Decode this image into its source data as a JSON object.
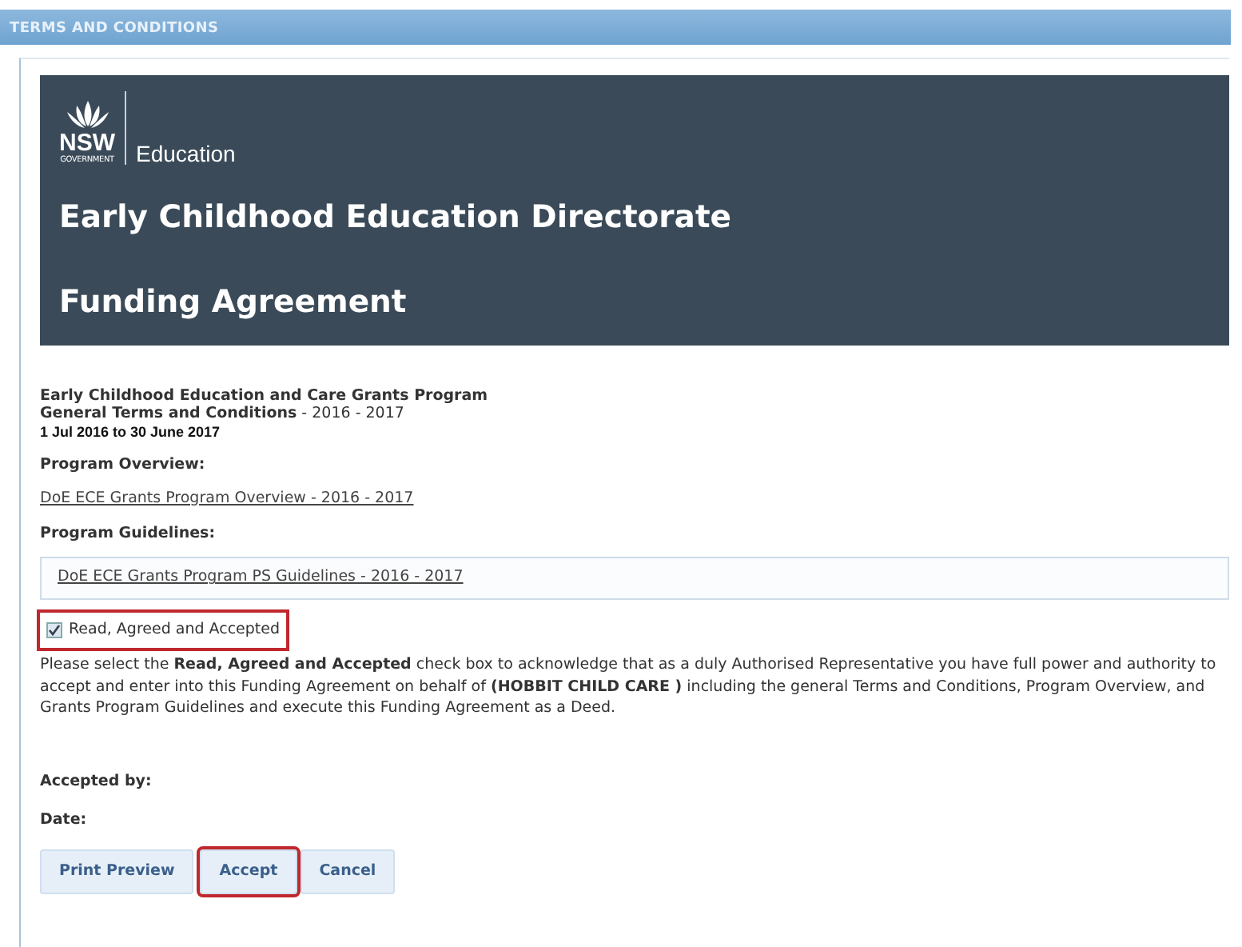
{
  "window": {
    "title": "TERMS AND CONDITIONS"
  },
  "header": {
    "logo_text": "NSW",
    "logo_subtext": "GOVERNMENT",
    "department": "Education",
    "title": "Early Childhood Education Directorate",
    "subtitle": "Funding Agreement"
  },
  "program": {
    "name": "Early Childhood Education and Care Grants Program",
    "terms": "General Terms and Conditions",
    "terms_years": " - 2016 - 2017",
    "period": "1 Jul 2016 to 30 June 2017"
  },
  "sections": [
    {
      "heading": "Program Overview:",
      "link": "DoE ECE Grants Program Overview - 2016 - 2017",
      "boxed": false
    },
    {
      "heading": "Program Guidelines:",
      "link": "DoE ECE Grants Program PS Guidelines - 2016 - 2017",
      "boxed": true
    }
  ],
  "agreement": {
    "label": "Read, Agreed and Accepted",
    "checked": true,
    "highlighted": true
  },
  "statement": "Please select the **Read, Agreed and Accepted** check box to acknowledge that as a duly Authorised Representative you have full power and authority to accept and enter into this Funding Agreement on behalf of **(HOBBIT CHILD CARE )** including the general Terms and Conditions, Program Overview, and Grants Program Guidelines and execute this Funding Agreement as a Deed.",
  "fields": [
    {
      "label": "Accepted by:"
    },
    {
      "label": "Date:"
    }
  ],
  "buttons": [
    {
      "label": "Print Preview",
      "highlighted": false
    },
    {
      "label": "Accept",
      "highlighted": true
    },
    {
      "label": "Cancel",
      "highlighted": false
    }
  ]
}
